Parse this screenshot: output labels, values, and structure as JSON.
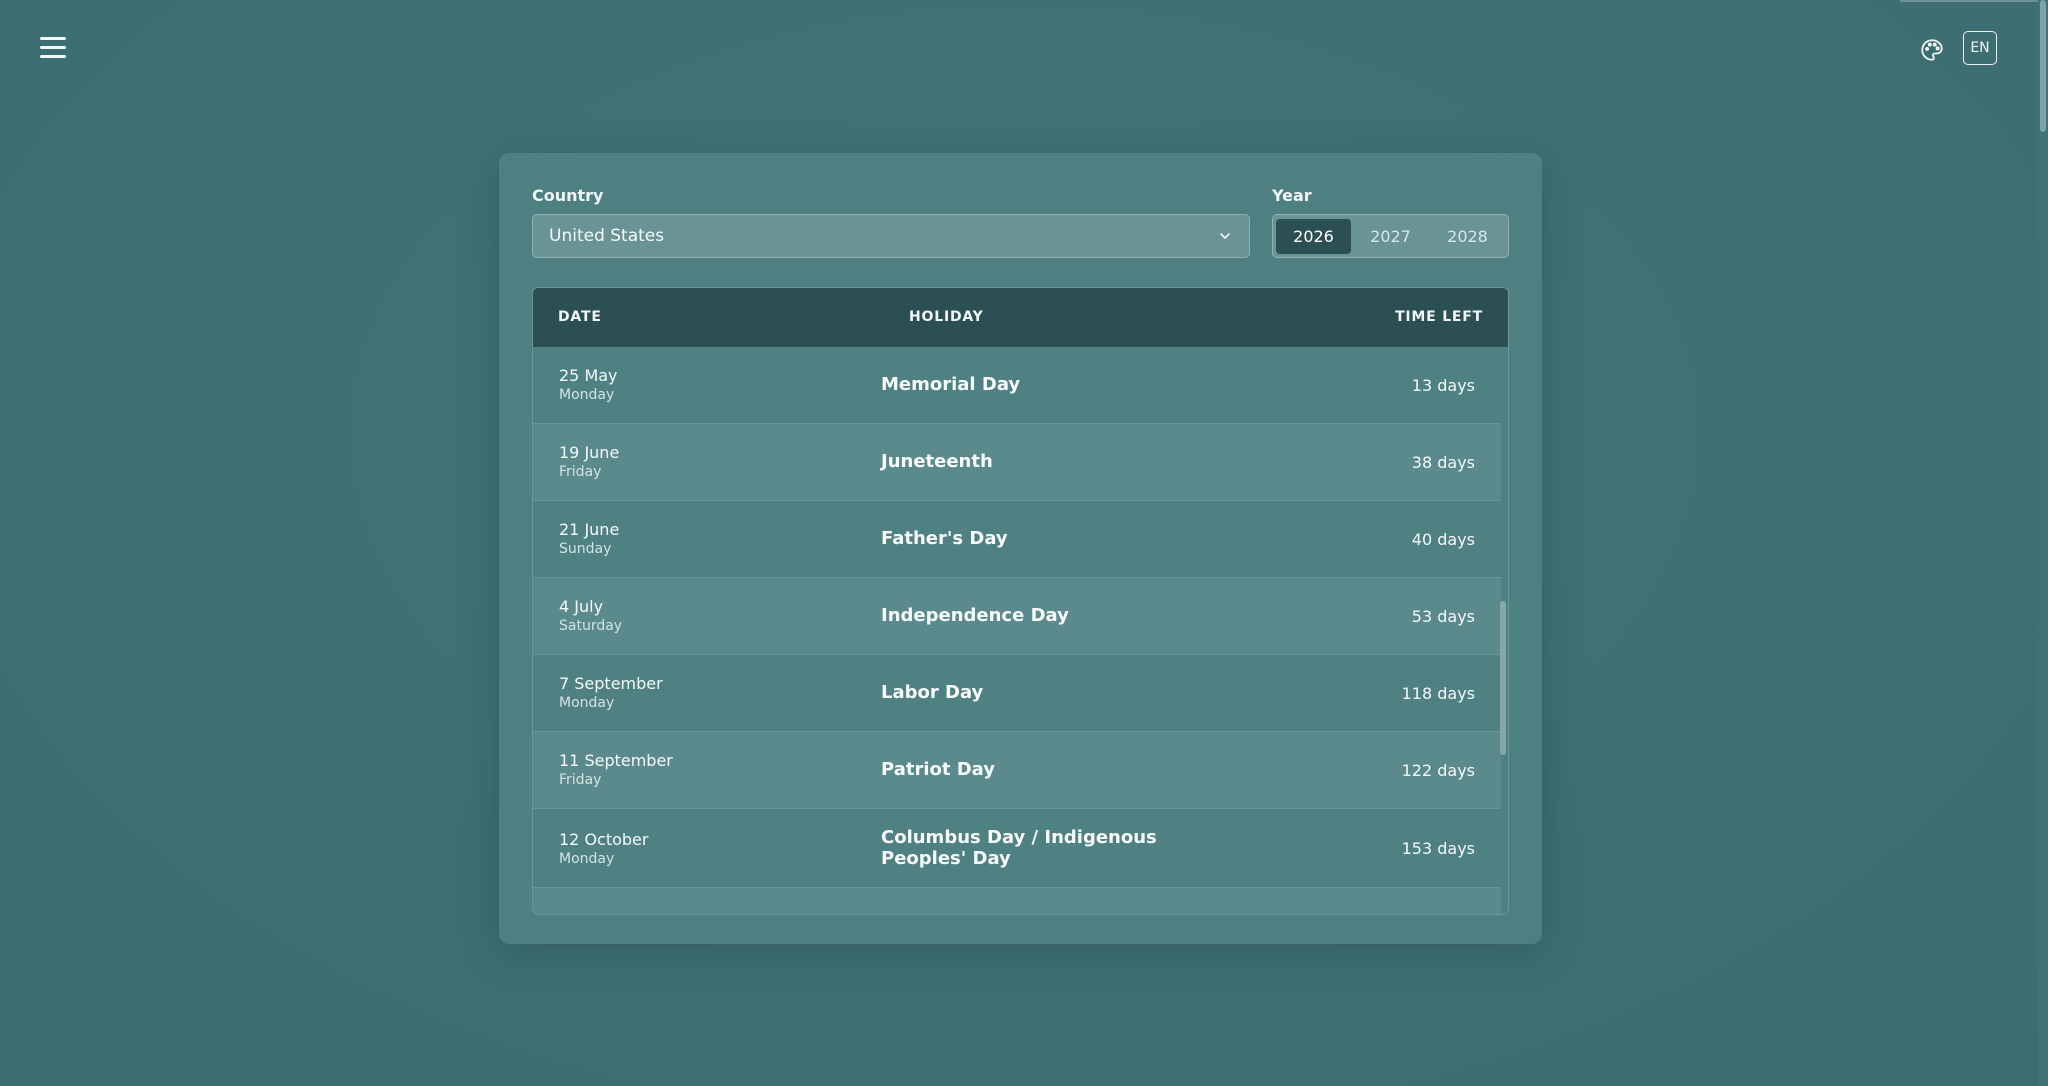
{
  "header": {
    "menu_icon": "hamburger-menu-icon",
    "palette_icon": "palette-icon",
    "language_label": "EN"
  },
  "filters": {
    "country_label": "Country",
    "country_value": "United States",
    "year_label": "Year",
    "years": [
      "2026",
      "2027",
      "2028"
    ],
    "selected_year": "2026"
  },
  "table": {
    "columns": {
      "date": "DATE",
      "holiday": "HOLIDAY",
      "time_left": "TIME LEFT"
    },
    "rows": [
      {
        "date": "25 May",
        "weekday": "Monday",
        "holiday": "Memorial Day",
        "time_left": "13 days"
      },
      {
        "date": "19 June",
        "weekday": "Friday",
        "holiday": "Juneteenth",
        "time_left": "38 days"
      },
      {
        "date": "21 June",
        "weekday": "Sunday",
        "holiday": "Father's Day",
        "time_left": "40 days"
      },
      {
        "date": "4 July",
        "weekday": "Saturday",
        "holiday": "Independence Day",
        "time_left": "53 days"
      },
      {
        "date": "7 September",
        "weekday": "Monday",
        "holiday": "Labor Day",
        "time_left": "118 days"
      },
      {
        "date": "11 September",
        "weekday": "Friday",
        "holiday": "Patriot Day",
        "time_left": "122 days"
      },
      {
        "date": "12 October",
        "weekday": "Monday",
        "holiday": "Columbus Day / Indigenous Peoples' Day",
        "time_left": "153 days"
      }
    ]
  },
  "colors": {
    "background": "#3f7275",
    "card": "#4e7f81",
    "table_header": "#2c4f53",
    "selected_year": "#2c4f53"
  }
}
